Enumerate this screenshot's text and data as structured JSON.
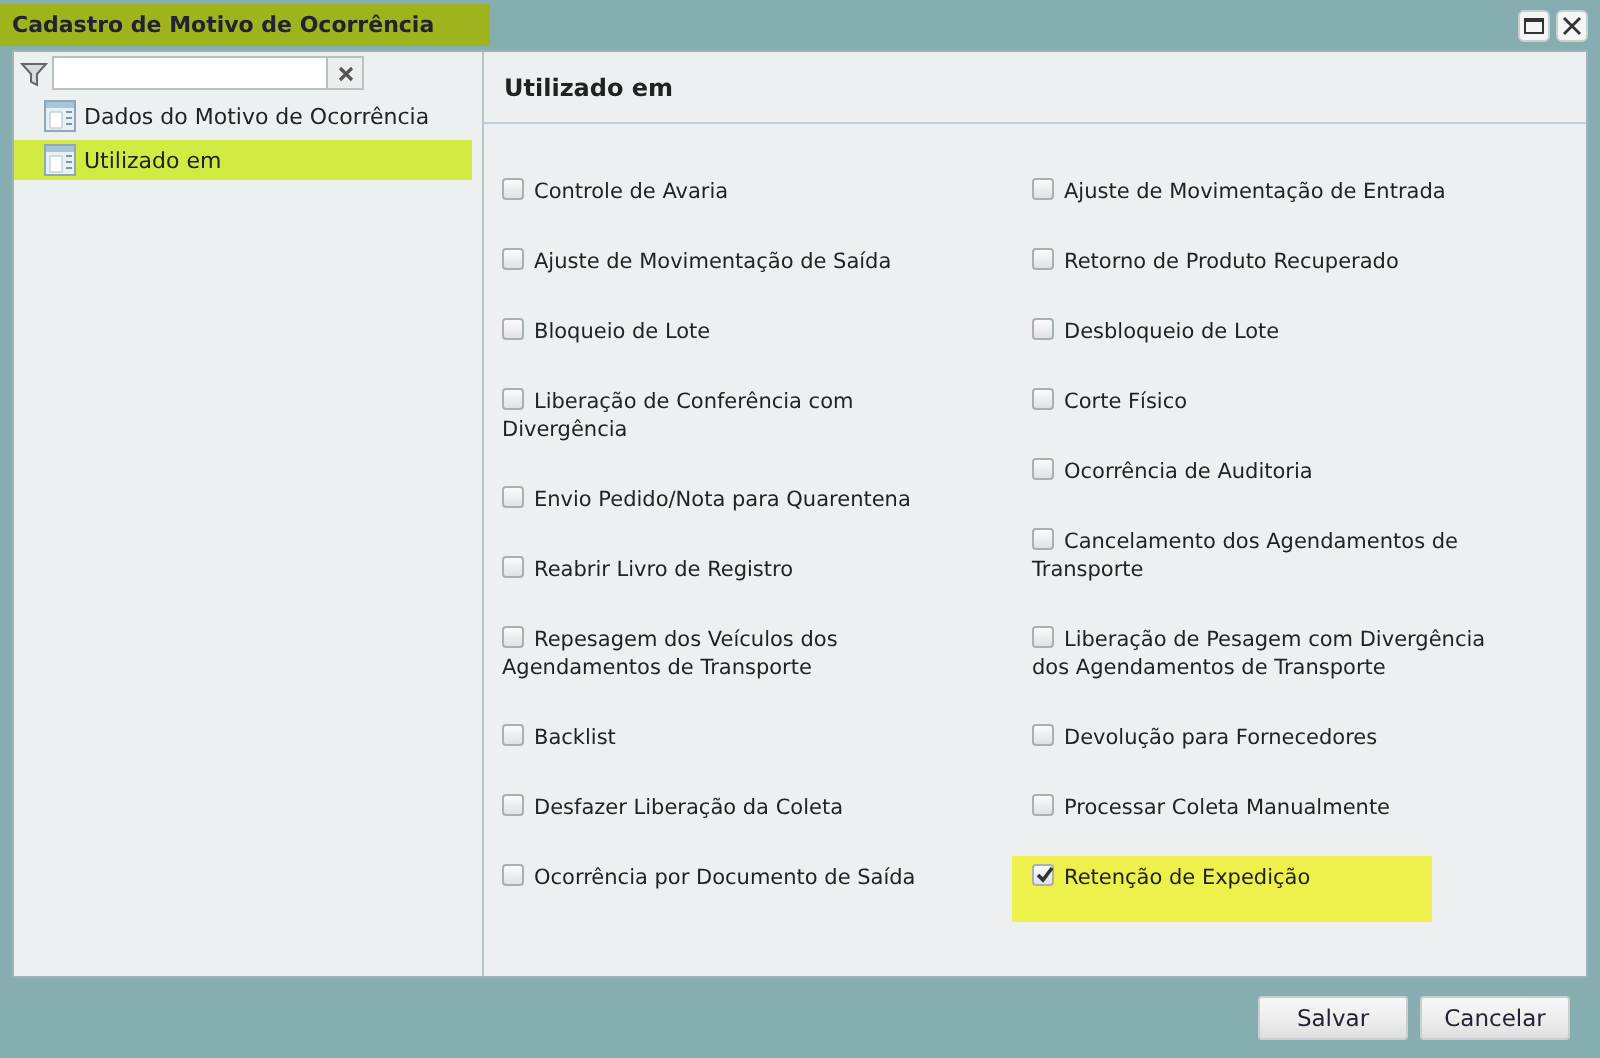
{
  "window": {
    "title": "Cadastro de Motivo de Ocorrência",
    "title_highlighted": true
  },
  "sidebar": {
    "items": [
      {
        "label": "Dados do Motivo de Ocorrência",
        "selected": false
      },
      {
        "label": "Utilizado em",
        "selected": true
      }
    ]
  },
  "panel": {
    "title": "Utilizado em",
    "left_column": [
      {
        "label": "Controle de Avaria",
        "checked": false,
        "highlighted": false
      },
      {
        "label": "Ajuste de Movimentação de Saída",
        "checked": false,
        "highlighted": false
      },
      {
        "label": "Bloqueio de Lote",
        "checked": false,
        "highlighted": false
      },
      {
        "label": "Liberação de Conferência com Divergência",
        "checked": false,
        "highlighted": false
      },
      {
        "label": "Envio Pedido/Nota para Quarentena",
        "checked": false,
        "highlighted": false
      },
      {
        "label": "Reabrir Livro de Registro",
        "checked": false,
        "highlighted": false
      },
      {
        "label": "Repesagem dos Veículos dos Agendamentos de Transporte",
        "checked": false,
        "highlighted": false
      },
      {
        "label": "Backlist",
        "checked": false,
        "highlighted": false
      },
      {
        "label": "Desfazer Liberação da Coleta",
        "checked": false,
        "highlighted": false
      },
      {
        "label": "Ocorrência por Documento de Saída",
        "checked": false,
        "highlighted": false
      }
    ],
    "right_column": [
      {
        "label": "Ajuste de Movimentação de Entrada",
        "checked": false,
        "highlighted": false
      },
      {
        "label": "Retorno de Produto Recuperado",
        "checked": false,
        "highlighted": false
      },
      {
        "label": "Desbloqueio de Lote",
        "checked": false,
        "highlighted": false
      },
      {
        "label": "Corte Físico",
        "checked": false,
        "highlighted": false
      },
      {
        "label": "Ocorrência de Auditoria",
        "checked": false,
        "highlighted": false
      },
      {
        "label": "Cancelamento dos Agendamentos de Transporte",
        "checked": false,
        "highlighted": false
      },
      {
        "label": "Liberação de Pesagem com Divergência dos Agendamentos de Transporte",
        "checked": false,
        "highlighted": false
      },
      {
        "label": "Devolução para Fornecedores",
        "checked": false,
        "highlighted": false
      },
      {
        "label": "Processar Coleta Manualmente",
        "checked": false,
        "highlighted": false
      },
      {
        "label": "Retenção de Expedição",
        "checked": true,
        "highlighted": true
      }
    ]
  },
  "buttons": [
    {
      "label": "Salvar"
    },
    {
      "label": "Cancelar"
    }
  ]
}
